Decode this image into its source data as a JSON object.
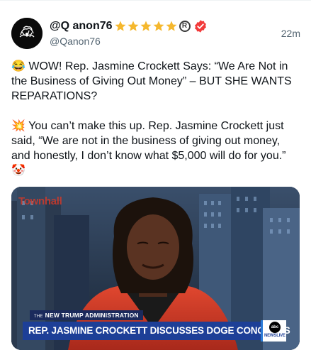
{
  "post": {
    "display_name": "@Q anon76",
    "handle": "@Qanon76",
    "time": "22m",
    "reg_mark": "R",
    "paragraph1": {
      "emoji": "😂",
      "text": "WOW! Rep. Jasmine Crockett Says: “We Are Not in the Business of Giving Out Money” – BUT SHE WANTS REPARATIONS?"
    },
    "paragraph2": {
      "emoji": "💥",
      "text": "You can’t make this up. Rep. Jasmine Crockett just said, “We are not in the business of giving out money, and honestly, I don’t know what $5,000 will do for you.”",
      "trailing_emoji": "🤡"
    }
  },
  "media": {
    "watermark": "Townhall",
    "banner_top_small": "THE",
    "banner_top": "NEW TRUMP ADMINISTRATION",
    "banner_main": "REP. JASMINE CROCKETT DISCUSSES DOGE CONCERNS",
    "logo_text": "abc",
    "logo_label": "NEWSLIVE"
  },
  "colors": {
    "star": "#f5b82e",
    "verified_badge": "#f23a3a",
    "lower_third": "#1d3f97",
    "watermark": "#d23a2a"
  },
  "icons": {
    "stars": [
      "star-icon",
      "star-icon",
      "star-icon",
      "star-icon",
      "star-icon"
    ],
    "verified": "verified-badge-icon"
  }
}
